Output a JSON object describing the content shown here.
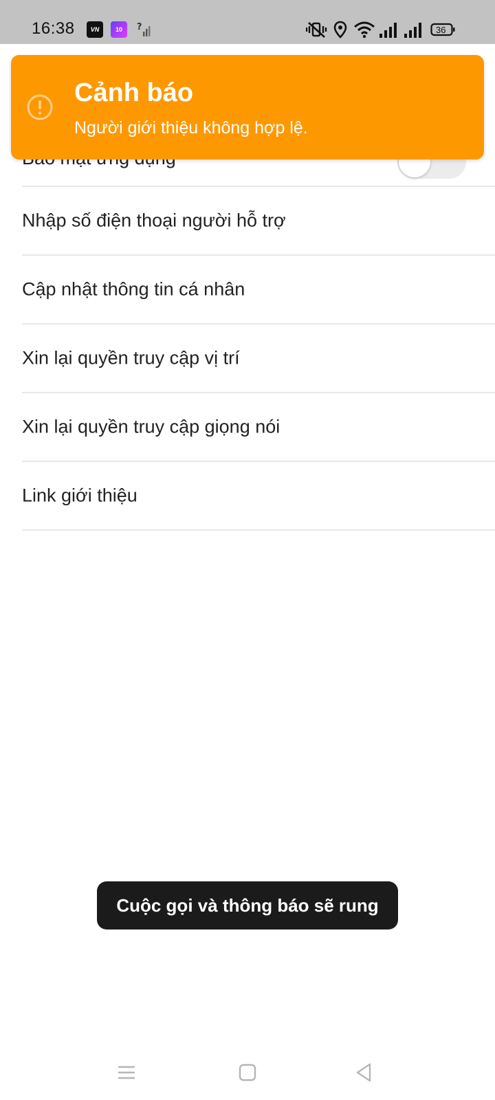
{
  "status_bar": {
    "time": "16:38",
    "icons": [
      "vn-app-icon",
      "ten-app-icon",
      "no-signal-icon",
      "vibrate-icon",
      "location-icon",
      "wifi-icon",
      "signal-icon",
      "signal-icon",
      "battery-icon"
    ],
    "app1_label": "VN",
    "app2_label": "10",
    "battery_level": "36"
  },
  "settings": {
    "items": [
      {
        "label": "Bảo mật ứng dụng",
        "has_toggle": true,
        "toggle_on": false
      },
      {
        "label": "Nhập số điện thoại người hỗ trợ"
      },
      {
        "label": "Cập nhật thông tin cá nhân"
      },
      {
        "label": "Xin lại quyền truy cập vị trí"
      },
      {
        "label": "Xin lại quyền truy cập giọng nói"
      },
      {
        "label": "Link giới thiệu"
      }
    ]
  },
  "alert": {
    "title": "Cảnh báo",
    "message": "Người giới thiệu không hợp lệ.",
    "icon": "warning-icon",
    "color": "#fe9800"
  },
  "toast": {
    "message": "Cuộc gọi và thông báo sẽ rung"
  },
  "nav_bar": {
    "icons": [
      "menu-icon",
      "home-icon",
      "back-icon"
    ]
  }
}
